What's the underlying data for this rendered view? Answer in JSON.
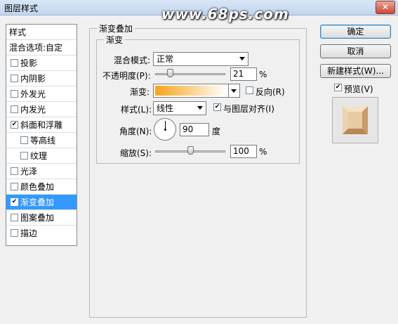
{
  "window": {
    "title": "图层样式",
    "close_label": "✕"
  },
  "watermark": "www.68ps.com",
  "left_panel": {
    "header": "样式",
    "blend_options": "混合选项:自定",
    "items": [
      {
        "label": "投影",
        "checked": false
      },
      {
        "label": "内阴影",
        "checked": false
      },
      {
        "label": "外发光",
        "checked": false
      },
      {
        "label": "内发光",
        "checked": false
      },
      {
        "label": "斜面和浮雕",
        "checked": true
      },
      {
        "label": "等高线",
        "checked": false
      },
      {
        "label": "纹理",
        "checked": false
      },
      {
        "label": "光泽",
        "checked": false
      },
      {
        "label": "颜色叠加",
        "checked": false
      },
      {
        "label": "渐变叠加",
        "checked": true
      },
      {
        "label": "图案叠加",
        "checked": false
      },
      {
        "label": "描边",
        "checked": false
      }
    ]
  },
  "gradient_overlay": {
    "group_title": "渐变叠加",
    "subgroup_title": "渐变",
    "blend_mode_label": "混合模式:",
    "blend_mode_value": "正常",
    "opacity_label": "不透明度(P):",
    "opacity_value": "21",
    "opacity_unit": "%",
    "opacity_fraction": 0.21,
    "gradient_label": "渐变:",
    "gradient_colors": [
      "#f7a51b",
      "#ffffff"
    ],
    "reverse_label": "反向(R)",
    "reverse_checked": false,
    "style_label": "样式(L):",
    "style_value": "线性",
    "align_label": "与图层对齐(I)",
    "align_checked": true,
    "angle_label": "角度(N):",
    "angle_value": "90",
    "angle_unit": "度",
    "scale_label": "缩放(S):",
    "scale_value": "100",
    "scale_unit": "%",
    "scale_fraction": 0.5
  },
  "right_panel": {
    "ok_label": "确定",
    "cancel_label": "取消",
    "new_style_label": "新建样式(W)...",
    "preview_label": "预览(V)",
    "preview_checked": true
  },
  "colors": {
    "selected": "#3399ff",
    "accent": "#3c7fb1"
  }
}
